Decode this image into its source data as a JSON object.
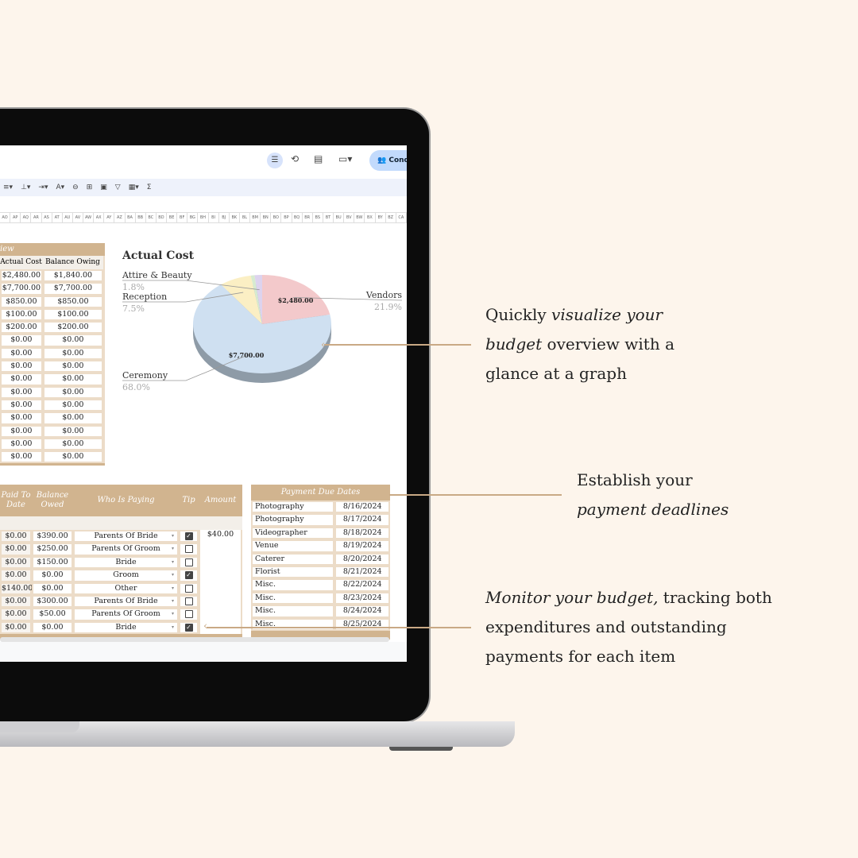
{
  "toolbar": {
    "conditional_label": "Cond",
    "sum_icon": "Σ"
  },
  "column_headers": [
    "AO",
    "AP",
    "AQ",
    "AR",
    "AS",
    "AT",
    "AU",
    "AV",
    "AW",
    "AX",
    "AY",
    "AZ",
    "BA",
    "BB",
    "BC",
    "BD",
    "BE",
    "BF",
    "BG",
    "BH",
    "BI",
    "BJ",
    "BK",
    "BL",
    "BM",
    "BN",
    "BO",
    "BP",
    "BQ",
    "BR",
    "BS",
    "BT",
    "BU",
    "BV",
    "BW",
    "BX",
    "BY",
    "BZ",
    "CA"
  ],
  "overview": {
    "title_fragment": "iew",
    "headers": [
      "Actual Cost",
      "Balance Owing"
    ],
    "rows": [
      [
        "$2,480.00",
        "$1,840.00"
      ],
      [
        "$7,700.00",
        "$7,700.00"
      ],
      [
        "$850.00",
        "$850.00"
      ],
      [
        "$100.00",
        "$100.00"
      ],
      [
        "$200.00",
        "$200.00"
      ],
      [
        "$0.00",
        "$0.00"
      ],
      [
        "$0.00",
        "$0.00"
      ],
      [
        "$0.00",
        "$0.00"
      ],
      [
        "$0.00",
        "$0.00"
      ],
      [
        "$0.00",
        "$0.00"
      ],
      [
        "$0.00",
        "$0.00"
      ],
      [
        "$0.00",
        "$0.00"
      ],
      [
        "$0.00",
        "$0.00"
      ],
      [
        "$0.00",
        "$0.00"
      ],
      [
        "$0.00",
        "$0.00"
      ]
    ]
  },
  "chart_data": {
    "type": "pie",
    "title": "Actual Cost",
    "slices": [
      {
        "name": "Vendors",
        "value": 2480,
        "percent": "21.9%",
        "data_label": "$2,480.00",
        "color": "#f3c9cb"
      },
      {
        "name": "Ceremony",
        "value": 7700,
        "percent": "68.0%",
        "data_label": "$7,700.00",
        "color": "#cfe0f1"
      },
      {
        "name": "Reception",
        "value": 850,
        "percent": "7.5%",
        "color": "#fbefc4"
      },
      {
        "name": "",
        "value": 100,
        "color": "#d7ebd0"
      },
      {
        "name": "Attire & Beauty",
        "value": 200,
        "percent": "1.8%",
        "color": "#ddd3ee"
      }
    ],
    "style": "3d"
  },
  "payments": {
    "headers": [
      "Paid To Date",
      "Balance Owed",
      "Who Is Paying",
      "Tip",
      "Amount"
    ],
    "rows": [
      [
        "$0.00",
        "$390.00",
        "Parents Of Bride",
        true,
        "$40.00"
      ],
      [
        "$0.00",
        "$250.00",
        "Parents Of Groom",
        false,
        ""
      ],
      [
        "$0.00",
        "$150.00",
        "Bride",
        false,
        ""
      ],
      [
        "$0.00",
        "$0.00",
        "Groom",
        true,
        ""
      ],
      [
        "$140.00",
        "$0.00",
        "Other",
        false,
        ""
      ],
      [
        "$0.00",
        "$300.00",
        "Parents Of Bride",
        false,
        ""
      ],
      [
        "$0.00",
        "$50.00",
        "Parents Of Groom",
        false,
        ""
      ],
      [
        "$0.00",
        "$0.00",
        "Bride",
        true,
        ""
      ]
    ]
  },
  "due_dates": {
    "title": "Payment Due Dates",
    "rows": [
      [
        "Photography",
        "8/16/2024"
      ],
      [
        "Photography",
        "8/17/2024"
      ],
      [
        "Videographer",
        "8/18/2024"
      ],
      [
        "Venue",
        "8/19/2024"
      ],
      [
        "Caterer",
        "8/20/2024"
      ],
      [
        "Florist",
        "8/21/2024"
      ],
      [
        "Misc.",
        "8/22/2024"
      ],
      [
        "Misc.",
        "8/23/2024"
      ],
      [
        "Misc.",
        "8/24/2024"
      ],
      [
        "Misc.",
        "8/25/2024"
      ]
    ]
  },
  "annotations": {
    "a1": {
      "pre": "Quickly ",
      "em": "visualize your budget",
      "post": " overview with a glance at a graph"
    },
    "a2": {
      "pre": "Establish your ",
      "em": "payment deadlines",
      "post": ""
    },
    "a3": {
      "pre": "",
      "em": "Monitor your budget,",
      "post": " tracking both expenditures and outstanding payments for each item"
    }
  },
  "colors": {
    "background": "#fdf5ec",
    "accent": "#d1b48f"
  }
}
